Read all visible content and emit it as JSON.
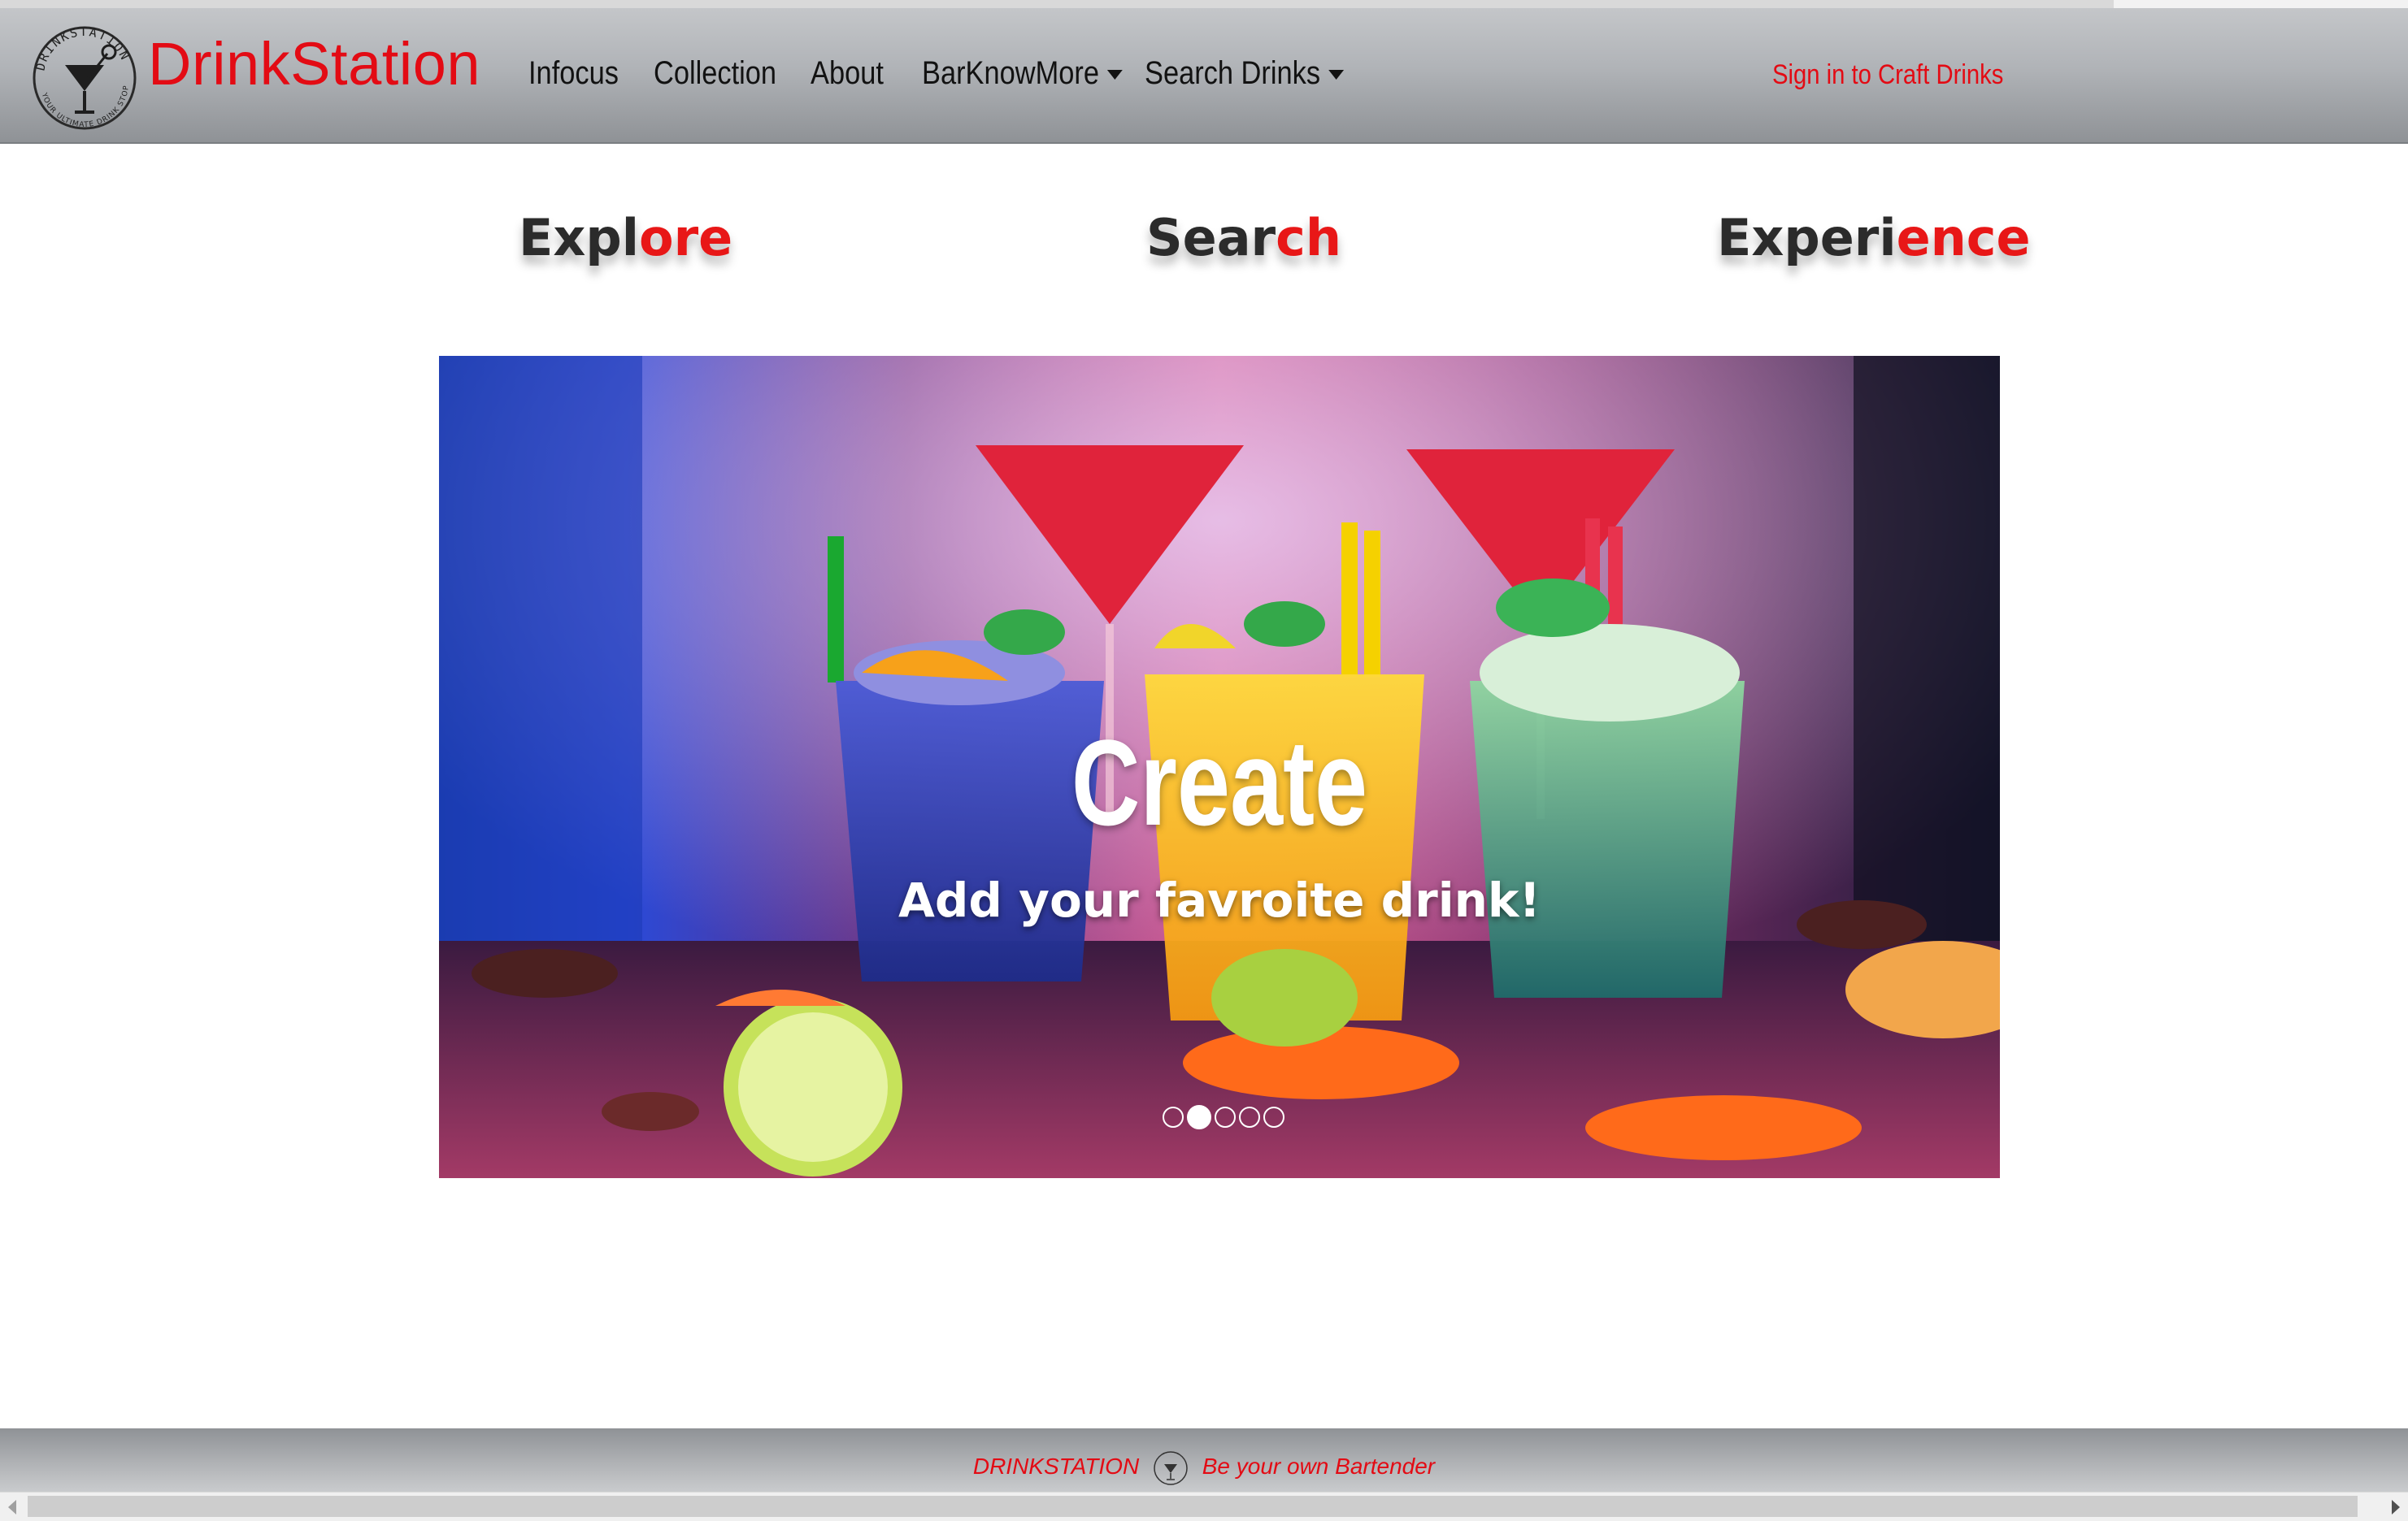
{
  "navbar": {
    "brand": "DrinkStation",
    "logo_text_top": "DRINKSTATION",
    "logo_text_bottom": "YOUR ULTIMATE DRINK STOP",
    "items": [
      {
        "label": "Infocus"
      },
      {
        "label": "Collection"
      },
      {
        "label": "About"
      },
      {
        "label": "BarKnowMore",
        "dropdown": true
      },
      {
        "label": "Search Drinks",
        "dropdown": true
      }
    ],
    "signin": "Sign in to Craft Drinks"
  },
  "taglines": [
    {
      "dark": "Expl",
      "accent": "ore"
    },
    {
      "dark": "Sear",
      "accent": "ch"
    },
    {
      "dark": "Experi",
      "accent": "ence"
    }
  ],
  "carousel": {
    "title": "Create",
    "subtitle": "Add your favroite drink!",
    "slide_count": 5,
    "active_index": 1
  },
  "footer": {
    "left": "DRINKSTATION",
    "right": "Be your own Bartender"
  },
  "colors": {
    "accent": "#e30b14",
    "nav_text": "#121212",
    "tagline_dark": "#2b2b2b"
  }
}
